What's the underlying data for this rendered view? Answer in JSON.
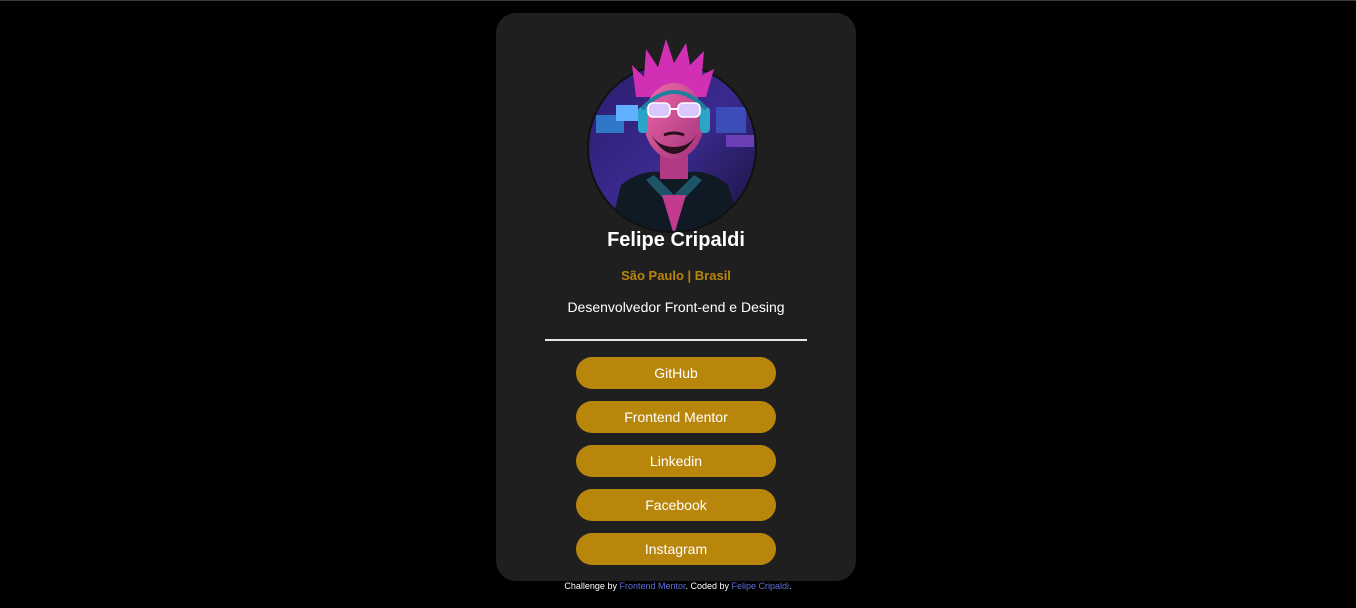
{
  "profile": {
    "name": "Felipe Cripaldi",
    "location": "São Paulo | Brasil",
    "bio": "Desenvolvedor Front-end e Desing"
  },
  "links": [
    {
      "label": "GitHub"
    },
    {
      "label": "Frontend Mentor"
    },
    {
      "label": "Linkedin"
    },
    {
      "label": "Facebook"
    },
    {
      "label": "Instagram"
    }
  ],
  "footer": {
    "prefix": "Challenge by ",
    "challenge_link": "Frontend Mentor",
    "middle": ". Coded by ",
    "author_link": "Felipe Cripaldi",
    "suffix": "."
  },
  "colors": {
    "background": "#000000",
    "card": "#1f1f1f",
    "accent": "#b8860b",
    "footer_link": "#5f6ed8"
  }
}
